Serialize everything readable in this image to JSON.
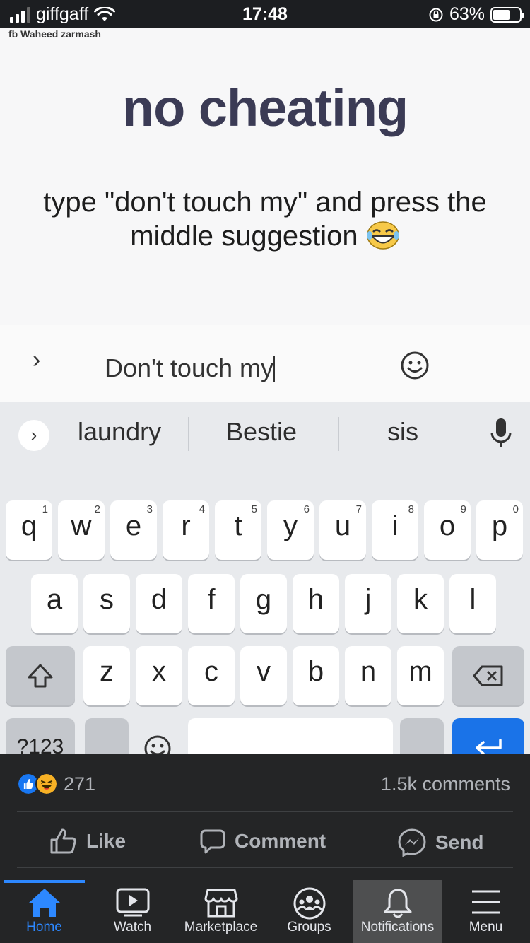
{
  "status_bar": {
    "carrier": "giffgaff",
    "time": "17:48",
    "battery": "63%",
    "battery_level": 0.63
  },
  "meme": {
    "watermark": "fb Waheed zarmash",
    "title": "no cheating",
    "instruction_line1": "type \"don't touch my\" and press the",
    "instruction_line2": "middle suggestion",
    "input_text": "Don't touch my",
    "suggestions": [
      "laundry",
      "Bestie",
      "sis"
    ],
    "keyboard": {
      "row1": [
        {
          "l": "q",
          "n": "1"
        },
        {
          "l": "w",
          "n": "2"
        },
        {
          "l": "e",
          "n": "3"
        },
        {
          "l": "r",
          "n": "4"
        },
        {
          "l": "t",
          "n": "5"
        },
        {
          "l": "y",
          "n": "6"
        },
        {
          "l": "u",
          "n": "7"
        },
        {
          "l": "i",
          "n": "8"
        },
        {
          "l": "o",
          "n": "9"
        },
        {
          "l": "p",
          "n": "0"
        }
      ],
      "row2": [
        "a",
        "s",
        "d",
        "f",
        "g",
        "h",
        "j",
        "k",
        "l"
      ],
      "row3": [
        "z",
        "x",
        "c",
        "v",
        "b",
        "n",
        "m"
      ],
      "symbols_key": "?123",
      "comma_key": ",",
      "period_key": "."
    }
  },
  "post": {
    "reaction_count": "271",
    "comments_count": "1.5k comments",
    "actions": {
      "like": "Like",
      "comment": "Comment",
      "send": "Send"
    }
  },
  "nav": {
    "items": [
      {
        "label": "Home",
        "icon": "home-icon"
      },
      {
        "label": "Watch",
        "icon": "watch-icon"
      },
      {
        "label": "Marketplace",
        "icon": "marketplace-icon"
      },
      {
        "label": "Groups",
        "icon": "groups-icon"
      },
      {
        "label": "Notifications",
        "icon": "bell-icon"
      },
      {
        "label": "Menu",
        "icon": "menu-icon"
      }
    ]
  },
  "colors": {
    "fb_blue": "#2d88ff",
    "fb_dark": "#242526",
    "enter_key": "#1a73e8",
    "title_color": "#3b3b55"
  }
}
